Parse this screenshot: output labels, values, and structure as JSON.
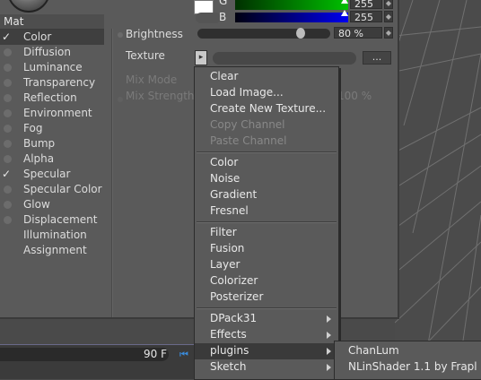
{
  "material": {
    "name": "Mat",
    "channels": [
      {
        "label": "Color",
        "checked": true,
        "selected": true
      },
      {
        "label": "Diffusion",
        "checked": false
      },
      {
        "label": "Luminance",
        "checked": false
      },
      {
        "label": "Transparency",
        "checked": false
      },
      {
        "label": "Reflection",
        "checked": false
      },
      {
        "label": "Environment",
        "checked": false
      },
      {
        "label": "Fog",
        "checked": false
      },
      {
        "label": "Bump",
        "checked": false
      },
      {
        "label": "Alpha",
        "checked": false
      },
      {
        "label": "Specular",
        "checked": true
      },
      {
        "label": "Specular Color",
        "checked": false
      },
      {
        "label": "Glow",
        "checked": false
      },
      {
        "label": "Displacement",
        "checked": false
      },
      {
        "label": "Illumination",
        "checked": null
      },
      {
        "label": "Assignment",
        "checked": null
      }
    ]
  },
  "color_panel": {
    "g_label": "G",
    "g_value": "255",
    "b_label": "B",
    "b_value": "255",
    "brightness_label": "Brightness",
    "brightness_value": "80 %",
    "brightness_fraction": 0.8,
    "texture_label": "Texture",
    "texture_more": "...",
    "mix_mode_label": "Mix Mode",
    "mix_strength_label": "Mix Strength",
    "mix_strength_value": "100 %",
    "swatch_color": "#ffffff"
  },
  "timeline": {
    "frame_value": "90 F"
  },
  "context_menu": {
    "group1": [
      {
        "label": "Clear",
        "enabled": true
      },
      {
        "label": "Load Image...",
        "enabled": true
      },
      {
        "label": "Create New Texture...",
        "enabled": true
      },
      {
        "label": "Copy Channel",
        "enabled": false
      },
      {
        "label": "Paste Channel",
        "enabled": false
      }
    ],
    "group2": [
      {
        "label": "Color"
      },
      {
        "label": "Noise"
      },
      {
        "label": "Gradient"
      },
      {
        "label": "Fresnel"
      }
    ],
    "group3": [
      {
        "label": "Filter"
      },
      {
        "label": "Fusion"
      },
      {
        "label": "Layer"
      },
      {
        "label": "Colorizer"
      },
      {
        "label": "Posterizer"
      }
    ],
    "group4": [
      {
        "label": "DPack31",
        "submenu": true
      },
      {
        "label": "Effects",
        "submenu": true
      },
      {
        "label": "plugins",
        "submenu": true,
        "highlighted": true
      },
      {
        "label": "Sketch",
        "submenu": true
      }
    ]
  },
  "plugins_submenu": [
    {
      "label": "ChanLum"
    },
    {
      "label": "NLinShader 1.1 by Frapl"
    }
  ],
  "colors": {
    "panel_bg": "#5a5a5a",
    "menu_highlight": "#3a3a3a",
    "accent_blue": "#3a8cdc"
  }
}
